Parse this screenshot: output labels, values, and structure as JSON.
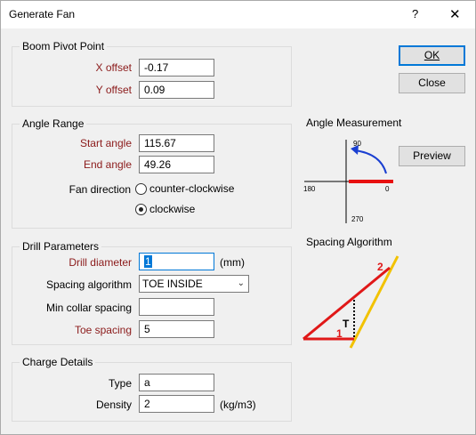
{
  "window": {
    "title": "Generate Fan",
    "help_glyph": "?",
    "close_glyph": "✕"
  },
  "boom_pivot": {
    "title": "Boom Pivot Point",
    "x_label": "X offset",
    "x_value": "-0.17",
    "y_label": "Y offset",
    "y_value": "0.09"
  },
  "angle_range": {
    "title": "Angle Range",
    "start_label": "Start angle",
    "start_value": "115.67",
    "end_label": "End angle",
    "end_value": "49.26",
    "direction_label": "Fan direction",
    "options": [
      "counter-clockwise",
      "clockwise"
    ],
    "selected": "clockwise"
  },
  "drill_params": {
    "title": "Drill Parameters",
    "diameter_label": "Drill diameter",
    "diameter_value": "1",
    "diameter_unit": "(mm)",
    "algorithm_label": "Spacing algorithm",
    "algorithm_value": "TOE INSIDE",
    "min_collar_label": "Min collar spacing",
    "min_collar_value": "",
    "toe_label": "Toe spacing",
    "toe_value": "5"
  },
  "charge_details": {
    "title": "Charge Details",
    "type_label": "Type",
    "type_value": "a",
    "density_label": "Density",
    "density_value": "2",
    "density_unit": "(kg/m3)"
  },
  "buttons": {
    "ok": "OK",
    "close": "Close",
    "preview": "Preview"
  },
  "angle_measurement": {
    "title": "Angle Measurement",
    "label_90": "90",
    "label_180": "180",
    "label_0": "0",
    "label_270": "270",
    "accent_red": "#e81010",
    "accent_blue": "#1a3fd1"
  },
  "spacing_algorithm": {
    "title": "Spacing Algorithm",
    "marker_1": "1",
    "marker_2": "2",
    "marker_t": "T",
    "line_red": "#e01818",
    "line_yellow": "#f2c200"
  }
}
